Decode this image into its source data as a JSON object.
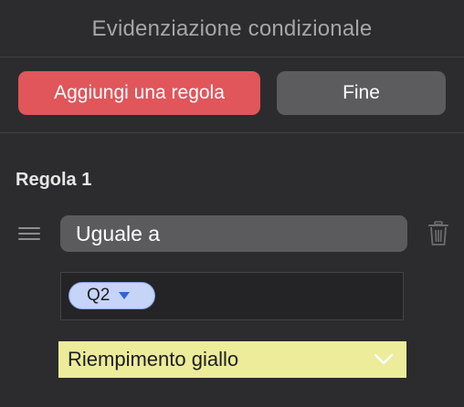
{
  "panel": {
    "title": "Evidenziazione condizionale"
  },
  "actions": {
    "add_rule_label": "Aggiungi una regola",
    "done_label": "Fine",
    "add_rule_color": "#e0565a",
    "done_color": "#5c5c5f"
  },
  "rule": {
    "title": "Regola 1",
    "condition": "Uguale a",
    "value_token": "Q2",
    "style": "Riempimento giallo",
    "style_color": "#ecec9a",
    "icons": {
      "drag": "drag-handle-icon",
      "delete": "trash-icon",
      "token_menu": "caret-down-icon",
      "style_menu": "chevron-down-icon"
    }
  }
}
